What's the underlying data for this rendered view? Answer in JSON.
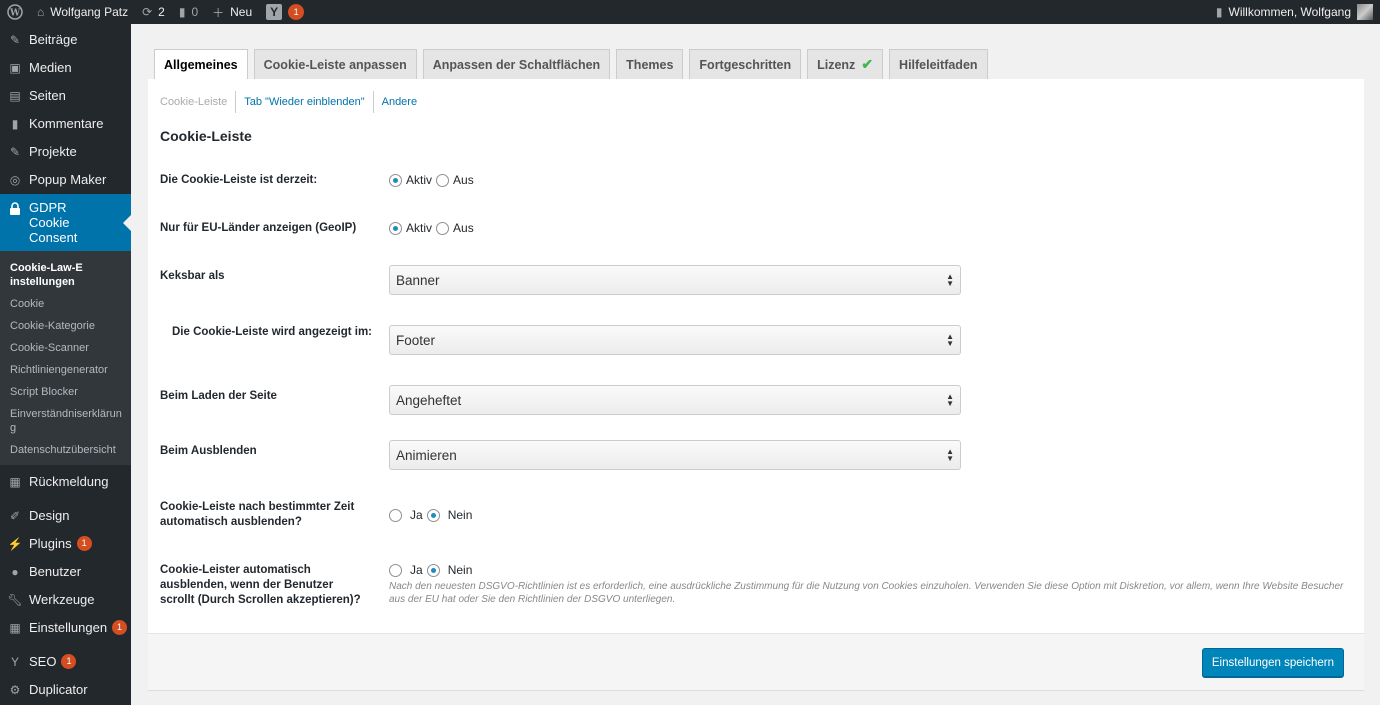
{
  "adminbar": {
    "site_name": "Wolfgang Patz",
    "updates_count": "2",
    "comments_count": "0",
    "new_label": "Neu",
    "seo_badge": "1",
    "welcome": "Willkommen, Wolfgang"
  },
  "sidebar": {
    "items_top": [
      {
        "label": "Beiträge",
        "icon": "pin-icon"
      },
      {
        "label": "Medien",
        "icon": "media-icon"
      },
      {
        "label": "Seiten",
        "icon": "page-icon"
      },
      {
        "label": "Kommentare",
        "icon": "comment-icon"
      },
      {
        "label": "Projekte",
        "icon": "pin-icon"
      },
      {
        "label": "Popup Maker",
        "icon": "popup-icon"
      }
    ],
    "current": {
      "label": "GDPR Cookie Consent",
      "icon": "lock-icon"
    },
    "submenu": [
      "Cookie-Law-Einstellungen",
      "Cookie",
      "Cookie-Kategorie",
      "Cookie-Scanner",
      "Richtliniengenerator",
      "Script Blocker",
      "Einverständniserklärung",
      "Datenschutzübersicht"
    ],
    "feedback": "Rückmeldung",
    "design": "Design",
    "plugins": "Plugins",
    "plugins_badge": "1",
    "users": "Benutzer",
    "tools": "Werkzeuge",
    "settings": "Einstellungen",
    "settings_badge": "1",
    "seo": "SEO",
    "seo_badge": "1",
    "duplicator": "Duplicator"
  },
  "tabs": [
    "Allgemeines",
    "Cookie-Leiste anpassen",
    "Anpassen der Schaltflächen",
    "Themes",
    "Fortgeschritten",
    "Lizenz",
    "Hilfeleitfaden"
  ],
  "subnav": [
    "Cookie-Leiste",
    "Tab \"Wieder einblenden\"",
    "Andere"
  ],
  "section_title": "Cookie-Leiste",
  "fields": {
    "status": {
      "label": "Die Cookie-Leiste ist derzeit:",
      "opt1": "Aktiv",
      "opt2": "Aus",
      "selected": "Aktiv"
    },
    "geoip": {
      "label": "Nur für EU-Länder anzeigen (GeoIP)",
      "opt1": "Aktiv",
      "opt2": "Aus",
      "selected": "Aktiv"
    },
    "bar_as": {
      "label": "Keksbar als",
      "value": "Banner"
    },
    "position": {
      "label": "Die Cookie-Leiste wird angezeigt im:",
      "value": "Footer"
    },
    "on_load": {
      "label": "Beim Laden der Seite",
      "value": "Angeheftet"
    },
    "on_hide": {
      "label": "Beim Ausblenden",
      "value": "Animieren"
    },
    "auto_hide": {
      "label": "Cookie-Leiste nach bestimmter Zeit automatisch ausblenden?",
      "opt1": "Ja",
      "opt2": "Nein",
      "selected": "Nein"
    },
    "scroll_hide": {
      "label": "Cookie-Leister automatisch ausblenden, wenn der Benutzer scrollt (Durch Scrollen akzeptieren)?",
      "opt1": "Ja",
      "opt2": "Nein",
      "selected": "Nein",
      "help": "Nach den neuesten DSGVO-Richtlinien ist es erforderlich, eine ausdrückliche Zustimmung für die Nutzung von Cookies einzuholen. Verwenden Sie diese Option mit Diskretion, vor allem, wenn Ihre Website Besucher aus der EU hat oder Sie den Richtlinien der DSGVO unterliegen."
    }
  },
  "save_button": "Einstellungen speichern"
}
